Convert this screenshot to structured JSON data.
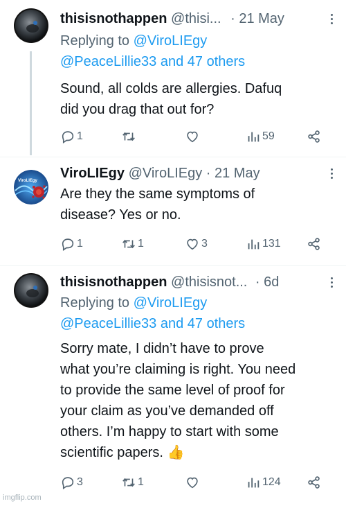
{
  "tweets": [
    {
      "name": "thisisnothappen",
      "handle": "@thisi...",
      "time": "· 21 May",
      "replying_prefix": "Replying to ",
      "replying_to": "@ViroLIEgy",
      "replying_more": "@PeaceLillie33 and 47 others",
      "body": [
        "Sound, all colds are allergies. Dafuq",
        "did you drag that out for?"
      ],
      "replies": "1",
      "retweets": "",
      "likes": "",
      "views": "59"
    },
    {
      "name": "ViroLIEgy",
      "handle": "@ViroLIEgy",
      "time": "· 21 May",
      "avatar_text": "ViroLIEgy",
      "body": [
        "Are they the same symptoms of",
        "disease? Yes or no."
      ],
      "replies": "1",
      "retweets": "1",
      "likes": "3",
      "views": "131"
    },
    {
      "name": "thisisnothappen",
      "handle": "@thisisnot...",
      "time": "· 6d",
      "replying_prefix": "Replying to ",
      "replying_to": "@ViroLIEgy",
      "replying_more": "@PeaceLillie33 and 47 others",
      "body": [
        "Sorry mate, I didn’t have to prove",
        "what you’re claiming is right. You need",
        "to provide the same level of proof for",
        "your claim as you’ve demanded off",
        "others. I’m happy to start with some",
        "scientific papers. 👍"
      ],
      "replies": "3",
      "retweets": "1",
      "likes": "",
      "views": "124"
    }
  ],
  "icons": {
    "reply": "reply-icon",
    "retweet": "retweet-icon",
    "like": "heart-icon",
    "views": "views-icon",
    "share": "share-icon",
    "more": "more-icon"
  },
  "colors": {
    "link": "#1d9bf0",
    "muted": "#536471",
    "text": "#0f1419"
  },
  "watermark": "imgflip.com"
}
